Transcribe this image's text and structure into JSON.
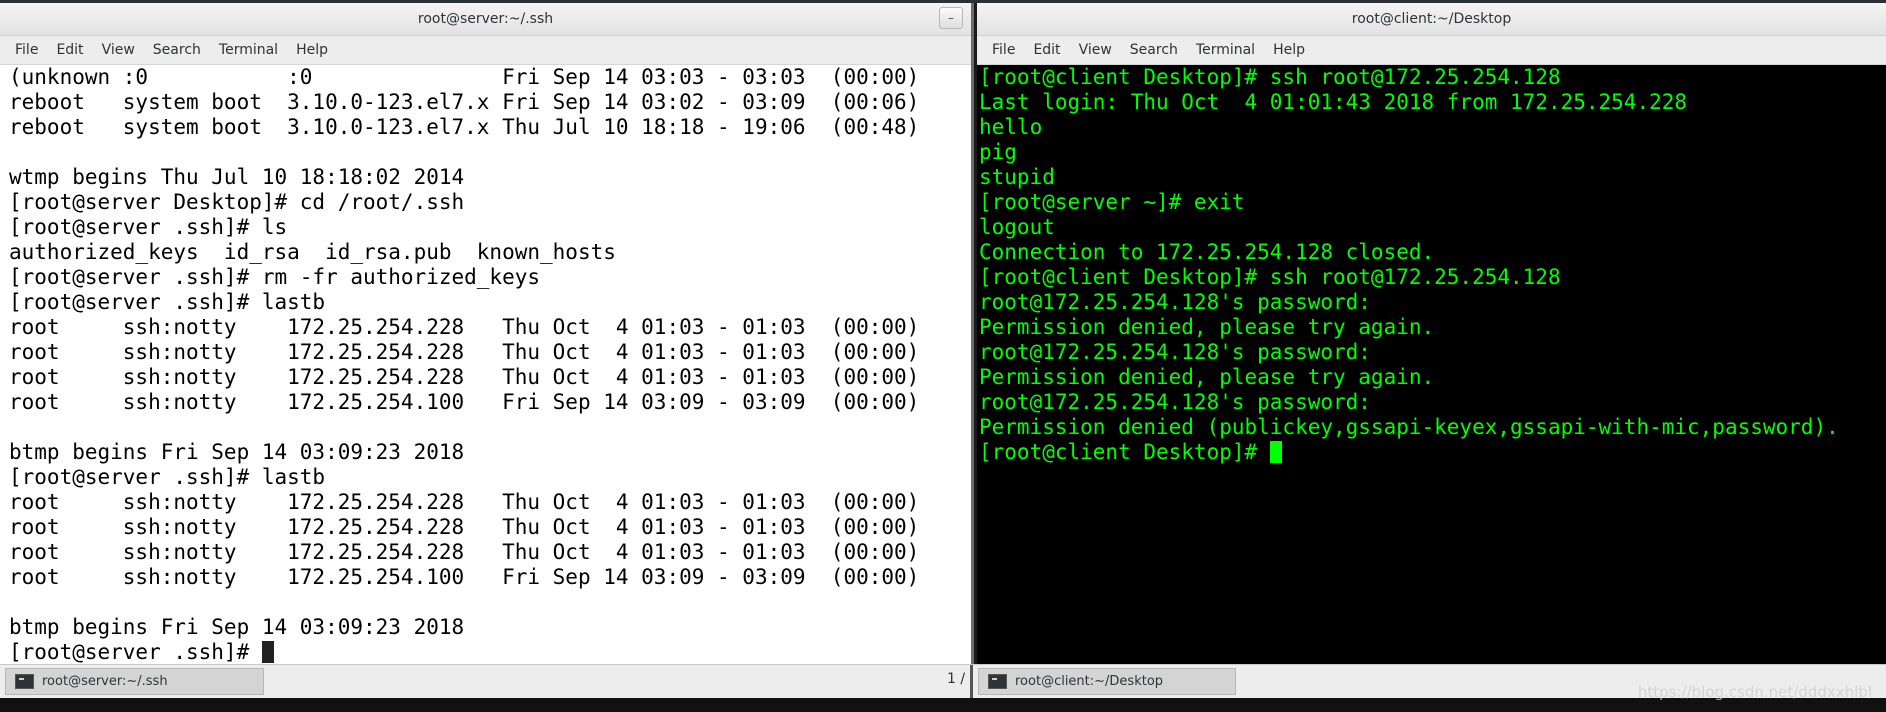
{
  "server_window": {
    "title": "root@server:~/.ssh",
    "close_glyph": "–",
    "menu": [
      "File",
      "Edit",
      "View",
      "Search",
      "Terminal",
      "Help"
    ],
    "lines": [
      "(unknown :0           :0               Fri Sep 14 03:03 - 03:03  (00:00)",
      "reboot   system boot  3.10.0-123.el7.x Fri Sep 14 03:02 - 03:09  (00:06)",
      "reboot   system boot  3.10.0-123.el7.x Thu Jul 10 18:18 - 19:06  (00:48)",
      "",
      "wtmp begins Thu Jul 10 18:18:02 2014",
      "[root@server Desktop]# cd /root/.ssh",
      "[root@server .ssh]# ls",
      "authorized_keys  id_rsa  id_rsa.pub  known_hosts",
      "[root@server .ssh]# rm -fr authorized_keys",
      "[root@server .ssh]# lastb",
      "root     ssh:notty    172.25.254.228   Thu Oct  4 01:03 - 01:03  (00:00)",
      "root     ssh:notty    172.25.254.228   Thu Oct  4 01:03 - 01:03  (00:00)",
      "root     ssh:notty    172.25.254.228   Thu Oct  4 01:03 - 01:03  (00:00)",
      "root     ssh:notty    172.25.254.100   Fri Sep 14 03:09 - 03:09  (00:00)",
      "",
      "btmp begins Fri Sep 14 03:09:23 2018",
      "[root@server .ssh]# lastb",
      "root     ssh:notty    172.25.254.228   Thu Oct  4 01:03 - 01:03  (00:00)",
      "root     ssh:notty    172.25.254.228   Thu Oct  4 01:03 - 01:03  (00:00)",
      "root     ssh:notty    172.25.254.228   Thu Oct  4 01:03 - 01:03  (00:00)",
      "root     ssh:notty    172.25.254.100   Fri Sep 14 03:09 - 03:09  (00:00)",
      "",
      "btmp begins Fri Sep 14 03:09:23 2018"
    ],
    "prompt": "[root@server .ssh]# ",
    "colors": {
      "background": "#ffffff",
      "text": "#000000"
    }
  },
  "client_window": {
    "title": "root@client:~/Desktop",
    "menu": [
      "File",
      "Edit",
      "View",
      "Search",
      "Terminal",
      "Help"
    ],
    "lines": [
      "[root@client Desktop]# ssh root@172.25.254.128",
      "Last login: Thu Oct  4 01:01:43 2018 from 172.25.254.228",
      "hello",
      "pig",
      "stupid",
      "[root@server ~]# exit",
      "logout",
      "Connection to 172.25.254.128 closed.",
      "[root@client Desktop]# ssh root@172.25.254.128",
      "root@172.25.254.128's password:",
      "Permission denied, please try again.",
      "root@172.25.254.128's password:",
      "Permission denied, please try again.",
      "root@172.25.254.128's password:",
      "Permission denied (publickey,gssapi-keyex,gssapi-with-mic,password)."
    ],
    "prompt": "[root@client Desktop]# ",
    "colors": {
      "background": "#000000",
      "text": "#00ff00"
    }
  },
  "taskbar": {
    "items": [
      {
        "label": "root@server:~/.ssh",
        "icon": "terminal-icon"
      },
      {
        "label": "root@client:~/Desktop",
        "icon": "terminal-icon"
      }
    ],
    "pager": "1 /"
  },
  "watermark": "https://blog.csdn.net/dddxxhlbl"
}
